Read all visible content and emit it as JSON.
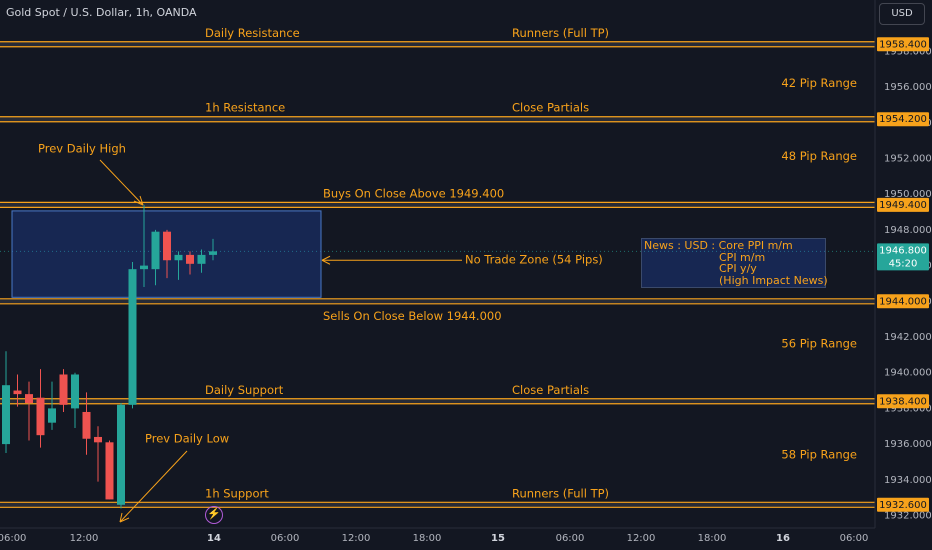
{
  "header": {
    "title": "Gold Spot / U.S. Dollar, 1h, OANDA",
    "currency": "USD"
  },
  "colors": {
    "background": "#131722",
    "level_line": "#f7a21b",
    "level_text": "#f7a21b",
    "bull": "#26a69a",
    "bear": "#ef5350",
    "axis_text": "#b2b5be",
    "current_price_label": "#26a69a",
    "zone_fill": "#2962ff"
  },
  "news": {
    "line1": "News : USD : Core PPI m/m",
    "line2": "CPI m/m",
    "line3": "CPI y/y",
    "line4": "(High Impact News)"
  },
  "event_icon": "lightning-icon",
  "chart_data": {
    "type": "candlestick",
    "title": "",
    "xlabel": "",
    "ylabel": "",
    "ylim": [
      1931.9,
      1960.4
    ],
    "y_ticks": [
      1932.0,
      1934.0,
      1936.0,
      1938.0,
      1940.0,
      1942.0,
      1944.0,
      1946.0,
      1948.0,
      1950.0,
      1952.0,
      1954.0,
      1956.0,
      1958.0
    ],
    "x_ticks": [
      "06:00",
      "12:00",
      "14",
      "06:00",
      "12:00",
      "18:00",
      "15",
      "06:00",
      "12:00",
      "18:00",
      "16",
      "06:00"
    ],
    "x_ticks_bold": [
      "14",
      "15",
      "16"
    ],
    "candles": [
      {
        "o": 1936.0,
        "h": 1941.2,
        "l": 1935.5,
        "c": 1939.3
      },
      {
        "o": 1939.0,
        "h": 1939.9,
        "l": 1938.1,
        "c": 1938.8
      },
      {
        "o": 1938.8,
        "h": 1939.5,
        "l": 1936.2,
        "c": 1938.3
      },
      {
        "o": 1938.6,
        "h": 1940.2,
        "l": 1935.8,
        "c": 1936.5
      },
      {
        "o": 1937.2,
        "h": 1939.5,
        "l": 1936.8,
        "c": 1938.0
      },
      {
        "o": 1939.9,
        "h": 1940.2,
        "l": 1937.8,
        "c": 1938.2
      },
      {
        "o": 1938.0,
        "h": 1940.0,
        "l": 1936.9,
        "c": 1939.9
      },
      {
        "o": 1937.8,
        "h": 1938.9,
        "l": 1935.4,
        "c": 1936.3
      },
      {
        "o": 1936.4,
        "h": 1937.0,
        "l": 1933.9,
        "c": 1936.1
      },
      {
        "o": 1936.1,
        "h": 1936.2,
        "l": 1932.9,
        "c": 1932.9
      },
      {
        "o": 1932.6,
        "h": 1938.3,
        "l": 1932.4,
        "c": 1938.2
      },
      {
        "o": 1938.2,
        "h": 1946.2,
        "l": 1938.0,
        "c": 1945.8
      },
      {
        "o": 1945.8,
        "h": 1949.4,
        "l": 1944.8,
        "c": 1946.0
      },
      {
        "o": 1945.8,
        "h": 1948.0,
        "l": 1944.9,
        "c": 1947.9
      },
      {
        "o": 1947.9,
        "h": 1948.0,
        "l": 1945.3,
        "c": 1946.3
      },
      {
        "o": 1946.3,
        "h": 1946.8,
        "l": 1945.2,
        "c": 1946.6
      },
      {
        "o": 1946.6,
        "h": 1946.8,
        "l": 1945.5,
        "c": 1946.1
      },
      {
        "o": 1946.1,
        "h": 1946.9,
        "l": 1945.6,
        "c": 1946.6
      },
      {
        "o": 1946.6,
        "h": 1947.5,
        "l": 1946.3,
        "c": 1946.8
      }
    ],
    "levels": [
      {
        "price": 1958.4,
        "label": "1958.400",
        "text_left": "Daily Resistance",
        "text_right": "Runners (Full TP)"
      },
      {
        "price": 1954.2,
        "label": "1954.200",
        "text_left": "1h Resistance",
        "text_right": "Close Partials"
      },
      {
        "price": 1949.4,
        "label": "1949.400",
        "text_left": "",
        "text_right": ""
      },
      {
        "price": 1944.0,
        "label": "1944.000",
        "text_left": "",
        "text_right": ""
      },
      {
        "price": 1938.4,
        "label": "1938.400",
        "text_left": "Daily Support",
        "text_right": "Close Partials"
      },
      {
        "price": 1932.6,
        "label": "1932.600",
        "text_left": "1h Support",
        "text_right": "Runners (Full TP)"
      }
    ],
    "buy_text": "Buys On Close Above 1949.400",
    "sell_text": "Sells On Close Below 1944.000",
    "zone": {
      "top": 1949.4,
      "bottom": 1944.0,
      "label": "No Trade Zone (54 Pips)"
    },
    "ranges": [
      {
        "price": 1956.2,
        "text": "42 Pip Range"
      },
      {
        "price": 1952.1,
        "text": "48 Pip Range"
      },
      {
        "price": 1941.6,
        "text": "56 Pip Range"
      },
      {
        "price": 1935.4,
        "text": "58 Pip Range"
      }
    ],
    "annotations": {
      "prev_high": "Prev Daily High",
      "prev_low": "Prev Daily Low"
    },
    "current_price": {
      "price": 1946.8,
      "label": "1946.800",
      "countdown": "45:20"
    }
  }
}
